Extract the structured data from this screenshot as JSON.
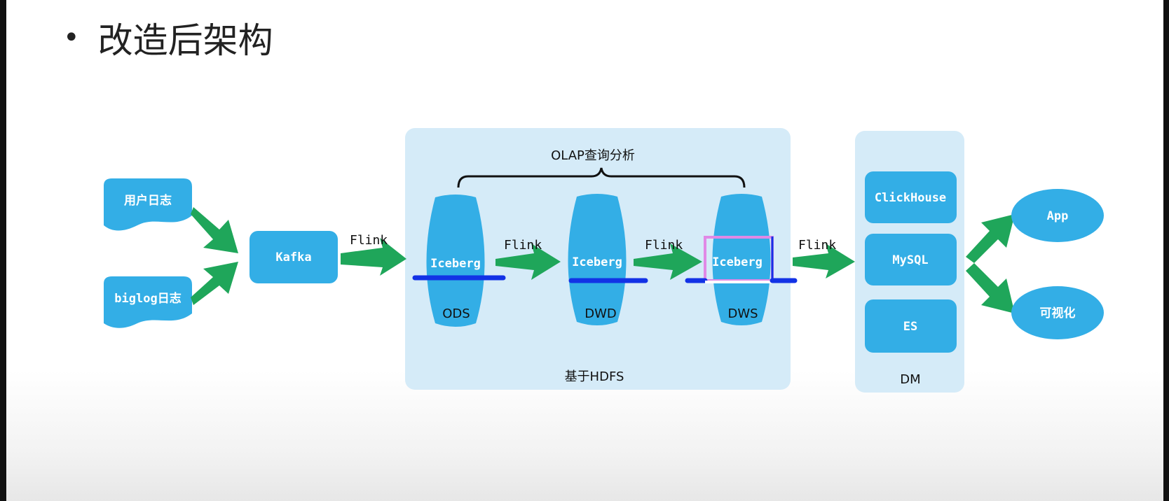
{
  "slide": {
    "title": "改造后架构"
  },
  "sources": [
    {
      "label": "用户日志"
    },
    {
      "label": "biglog日志"
    }
  ],
  "kafka": {
    "label": "Kafka"
  },
  "flink_labels": [
    "Flink",
    "Flink",
    "Flink",
    "Flink"
  ],
  "hdfs_panel": {
    "label": "基于HDFS",
    "olap_label": "OLAP查询分析",
    "layers": [
      {
        "table": "Iceberg",
        "layer": "ODS"
      },
      {
        "table": "Iceberg",
        "layer": "DWD"
      },
      {
        "table": "Iceberg",
        "layer": "DWS"
      }
    ]
  },
  "dm_panel": {
    "label": "DM",
    "stores": [
      {
        "label": "ClickHouse"
      },
      {
        "label": "MySQL"
      },
      {
        "label": "ES"
      }
    ]
  },
  "outputs": [
    {
      "label": "App"
    },
    {
      "label": "可视化"
    }
  ],
  "colors": {
    "node_blue": "#33aee6",
    "panel_light_blue": "#d5ebf8",
    "arrow_green": "#1fa65a",
    "underline_blue": "#1232e6",
    "highlight_pink": "#e089e6"
  }
}
